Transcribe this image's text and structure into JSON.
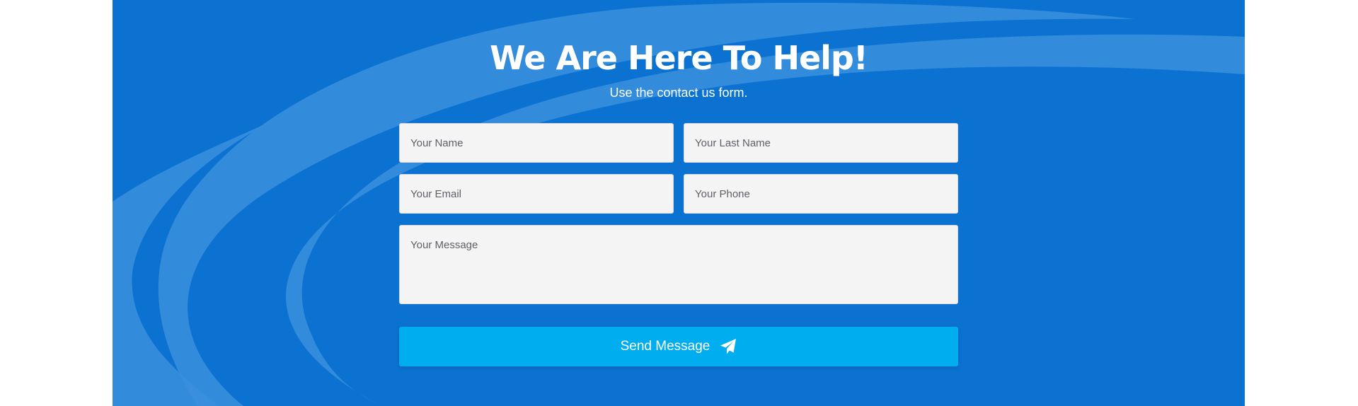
{
  "contact": {
    "title": "We Are Here To Help!",
    "subtitle": "Use the contact us form.",
    "fields": {
      "first_name_placeholder": "Your Name",
      "last_name_placeholder": "Your Last Name",
      "email_placeholder": "Your Email",
      "phone_placeholder": "Your Phone",
      "message_placeholder": "Your Message"
    },
    "submit_label": "Send Message",
    "submit_icon": "paper-plane-icon"
  },
  "colors": {
    "background": "#0b72d1",
    "swoosh": "#3b8fde",
    "button": "#00aeef",
    "field": "#f4f4f5"
  }
}
